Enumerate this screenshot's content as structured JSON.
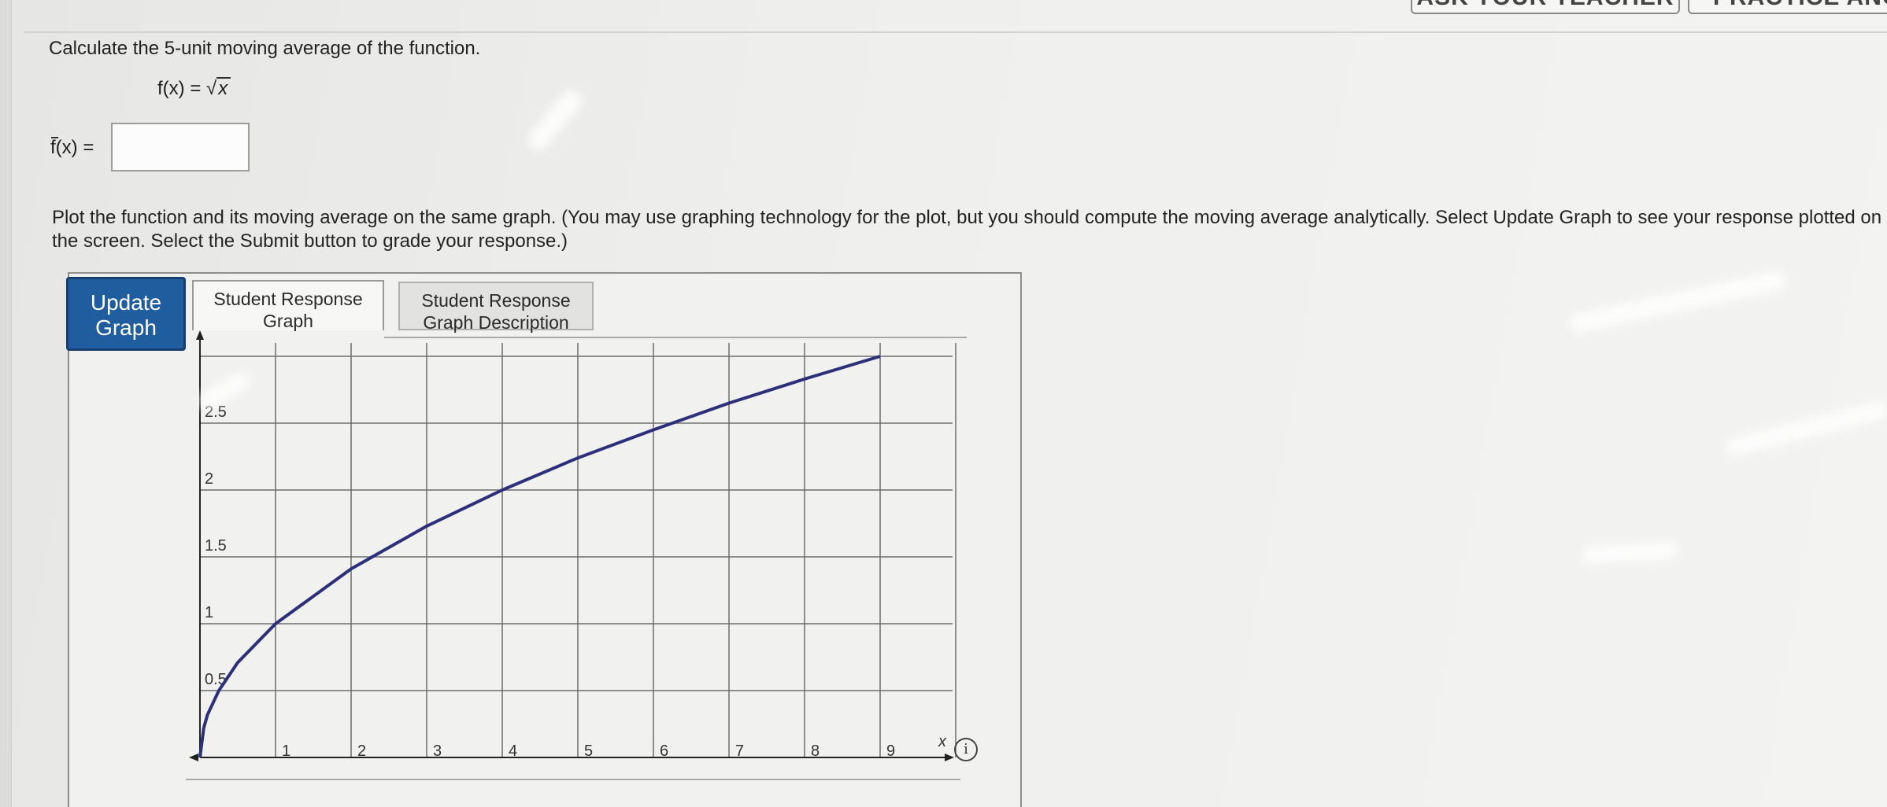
{
  "top_buttons": {
    "ask_teacher": "ASK YOUR TEACHER",
    "practice_another": "PRACTICE ANOT"
  },
  "question": {
    "prompt": "Calculate the 5-unit moving average of the function.",
    "function_lhs": "f(x) = ",
    "function_radicand": "x",
    "answer_label_f": "f",
    "answer_label_rest": "(x) = ",
    "answer_value": ""
  },
  "instructions": "Plot the function and its moving average on the same graph. (You may use graphing technology for the plot, but you should compute the moving average analytically. Select Update Graph to see your response plotted on the screen. Select the Submit button to grade your response.)",
  "graph_panel": {
    "update_button": "Update Graph",
    "tabs": [
      {
        "label": "Student Response Graph",
        "active": true
      },
      {
        "label": "Student Response Graph Description",
        "active": false
      }
    ],
    "info_icon_glyph": "i"
  },
  "chart_data": {
    "type": "line",
    "title": "",
    "xlabel": "x",
    "ylabel": "",
    "xlim": [
      0,
      10
    ],
    "ylim": [
      0,
      3.1
    ],
    "x_ticks": [
      "1",
      "2",
      "3",
      "4",
      "5",
      "6",
      "7",
      "8",
      "9"
    ],
    "y_ticks": [
      "0.5",
      "1",
      "1.5",
      "2",
      "2.5"
    ],
    "grid": true,
    "series": [
      {
        "function": "sqrt(x)",
        "color": "#2d2f7a",
        "x": [
          0,
          0.05,
          0.1,
          0.25,
          0.5,
          1,
          2,
          3,
          4,
          5,
          6,
          7,
          8,
          9
        ],
        "y": [
          0,
          0.22,
          0.32,
          0.5,
          0.71,
          1,
          1.41,
          1.73,
          2,
          2.24,
          2.45,
          2.65,
          2.83,
          3
        ]
      }
    ]
  },
  "colors": {
    "update_button": "#1f5d9f",
    "curve": "#2d2f7a",
    "grid": "#6e6e6e"
  }
}
